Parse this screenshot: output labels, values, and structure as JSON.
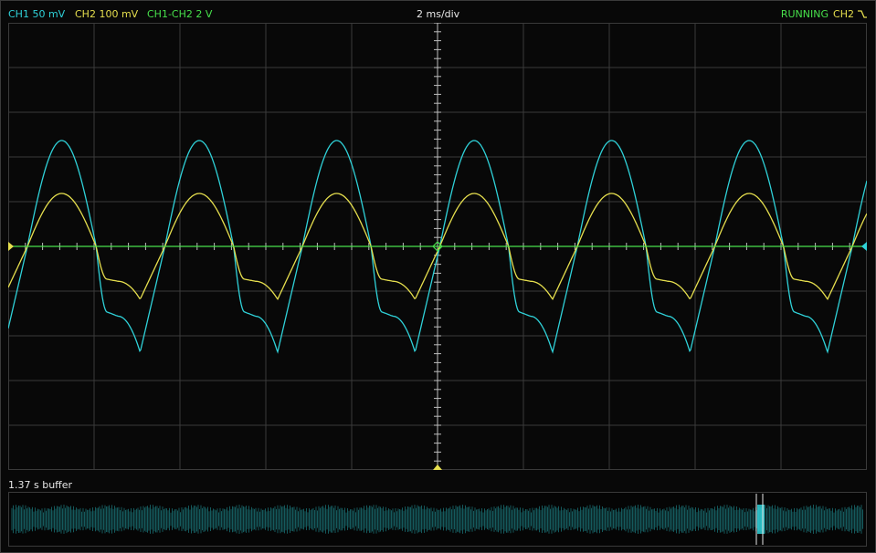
{
  "channels": {
    "ch1": {
      "label": "CH1 50 mV",
      "color": "#2fd1d8"
    },
    "ch2": {
      "label": "CH2 100 mV",
      "color": "#e6df4e"
    },
    "math": {
      "label": "CH1-CH2 2 V",
      "color": "#47e04b"
    }
  },
  "timebase": {
    "label": "2 ms/div"
  },
  "status": {
    "text": "RUNNING"
  },
  "trigger": {
    "channel": "CH2",
    "slope": "falling-edge-icon",
    "color": "#e6df4e"
  },
  "buffer": {
    "label": "1.37 s buffer"
  },
  "colors": {
    "background": "#080808",
    "grid": "#3a3a3a",
    "axis": "#bdbdbd"
  }
}
